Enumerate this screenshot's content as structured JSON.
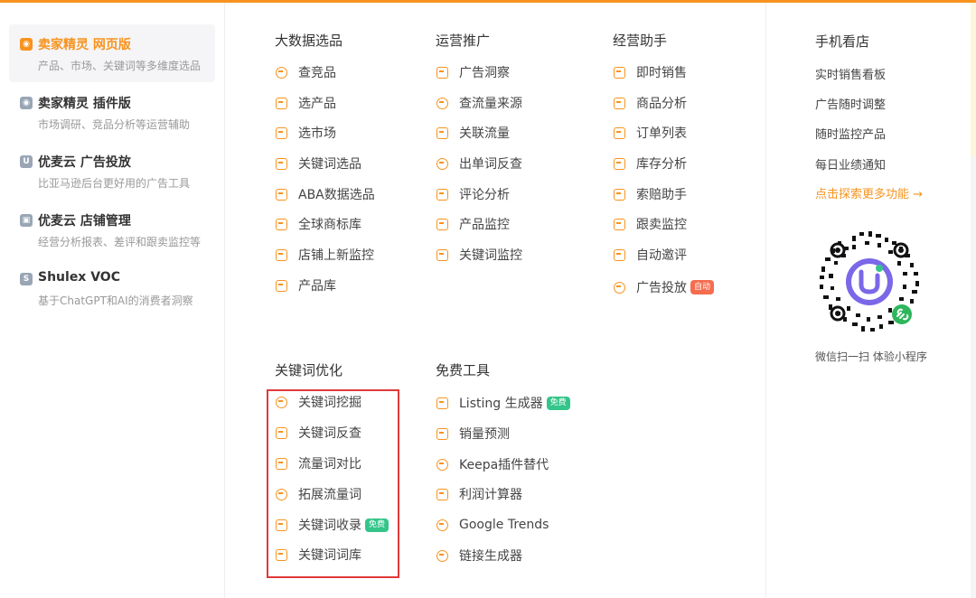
{
  "left_nav": [
    {
      "title": "卖家精灵 网页版",
      "desc": "产品、市场、关键词等多维度选品",
      "active": true,
      "icon": "sellersprite-web-icon"
    },
    {
      "title": "卖家精灵 插件版",
      "desc": "市场调研、竞品分析等运营辅助",
      "active": false,
      "icon": "sellersprite-plugin-icon"
    },
    {
      "title": "优麦云 广告投放",
      "desc": "比亚马逊后台更好用的广告工具",
      "active": false,
      "icon": "youmaiyun-ads-icon"
    },
    {
      "title": "优麦云 店铺管理",
      "desc": "经营分析报表、差评和跟卖监控等",
      "active": false,
      "icon": "youmaiyun-store-icon"
    },
    {
      "title": "Shulex VOC",
      "desc": "基于ChatGPT和AI的消费者洞察",
      "active": false,
      "icon": "shulex-voc-icon"
    }
  ],
  "columns": {
    "big_data": {
      "title": "大数据选品",
      "items": [
        "查竞品",
        "选产品",
        "选市场",
        "关键词选品",
        "ABA数据选品",
        "全球商标库",
        "店铺上新监控",
        "产品库"
      ]
    },
    "promotion": {
      "title": "运营推广",
      "items": [
        "广告洞察",
        "查流量来源",
        "关联流量",
        "出单词反查",
        "评论分析",
        "产品监控",
        "关键词监控"
      ]
    },
    "assistant": {
      "title": "经营助手",
      "items": [
        "即时销售",
        "商品分析",
        "订单列表",
        "库存分析",
        "索赔助手",
        "跟卖监控",
        "自动邀评",
        "广告投放"
      ],
      "auto_badge": "自动"
    },
    "keyword_opt": {
      "title": "关键词优化",
      "items": [
        "关键词挖掘",
        "关键词反查",
        "流量词对比",
        "拓展流量词",
        "关键词收录",
        "关键词词库"
      ],
      "free_badge": "免费"
    },
    "free_tools": {
      "title": "免费工具",
      "items": [
        "Listing 生成器",
        "销量预测",
        "Keepa插件替代",
        "利润计算器",
        "Google Trends",
        "链接生成器"
      ],
      "free_badge": "免费"
    },
    "mobile": {
      "title": "手机看店",
      "items": [
        "实时销售看板",
        "广告随时调整",
        "随时监控产品",
        "每日业绩通知"
      ],
      "explore_link": "点击探索更多功能 →",
      "qr_caption": "微信扫一扫 体验小程序"
    }
  },
  "colors": {
    "accent": "#f7931e",
    "free_badge": "#35c58a",
    "auto_badge": "#f56c4f",
    "highlight_box": "#e03a3a"
  }
}
